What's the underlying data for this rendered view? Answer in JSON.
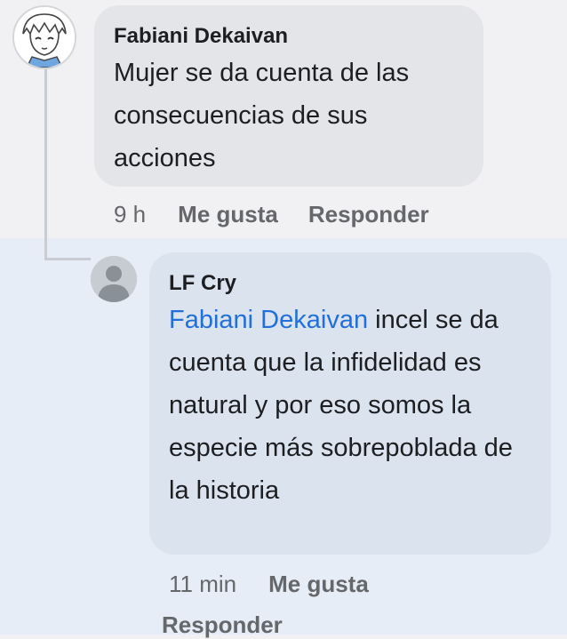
{
  "comments": [
    {
      "author": "Fabiani Dekaivan",
      "text": "Mujer se da cuenta de las consecuencias de sus acciones",
      "time": "9 h",
      "like_label": "Me gusta",
      "reply_label": "Responder"
    },
    {
      "author": "LF Cry",
      "mention": "Fabiani Dekaivan",
      "text": " incel se da cuenta que la infidelidad es natural y por eso somos la especie más sobrepoblada de la historia",
      "time": "11 min",
      "like_label": "Me gusta",
      "reply_label": "Responder"
    }
  ],
  "colors": {
    "mention": "#216fdb",
    "bubble_top": "#e4e5e9",
    "bubble_reply": "#dbe3ee",
    "action_text": "#65676b"
  },
  "icons": {
    "avatar_1": "anime-profile-avatar-icon",
    "avatar_2": "default-user-avatar-icon"
  }
}
